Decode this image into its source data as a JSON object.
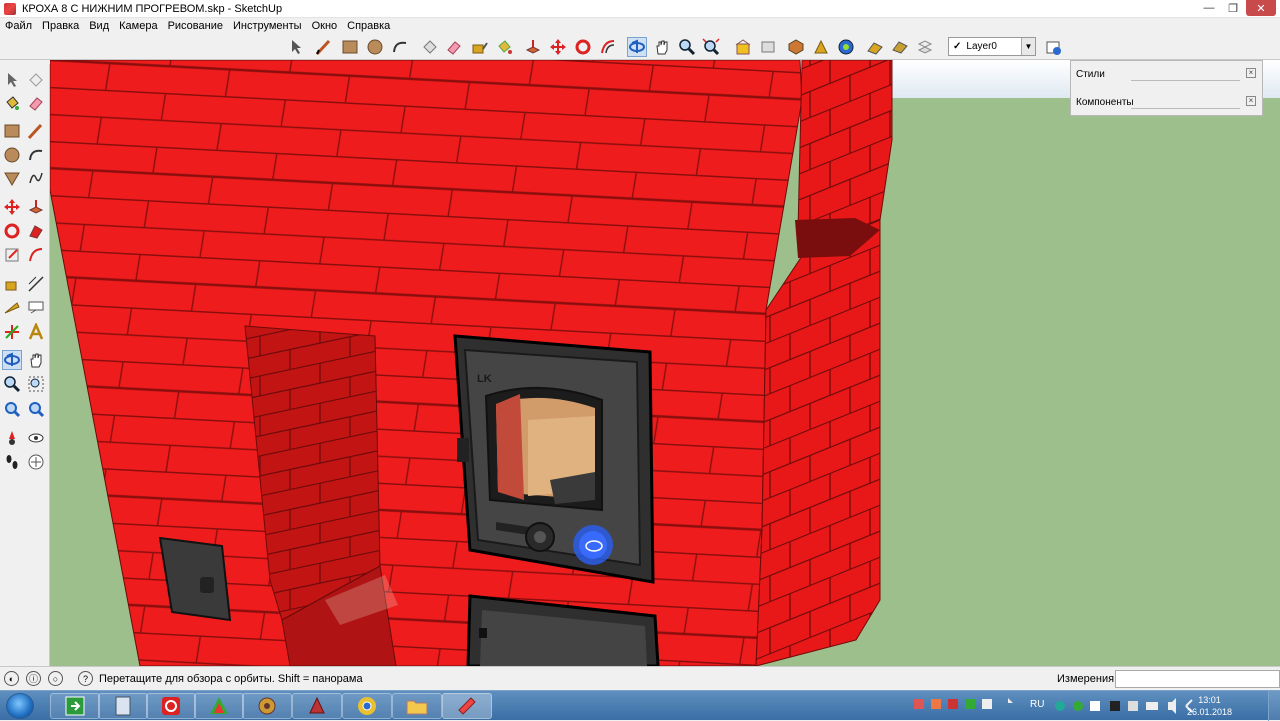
{
  "window": {
    "title": "КРОХА 8 С НИЖНИМ ПРОГРЕВОМ.skp - SketchUp"
  },
  "menu": [
    "Файл",
    "Правка",
    "Вид",
    "Камера",
    "Рисование",
    "Инструменты",
    "Окно",
    "Справка"
  ],
  "layer": {
    "current": "Layer0"
  },
  "tray": {
    "styles_label": "Стили",
    "components_label": "Компоненты"
  },
  "status": {
    "hint": "Перетащите для обзора с орбиты.  Shift = панорама",
    "measurements_label": "Измерения",
    "measurements_value": ""
  },
  "taskbar": {
    "lang": "RU",
    "time": "13:01",
    "date": "26.01.2018"
  },
  "colors": {
    "brick": "#ee1c1c",
    "mortar": "#9b1010",
    "ground": "#9dbf8b",
    "door_iron": "#3c3c3c"
  }
}
